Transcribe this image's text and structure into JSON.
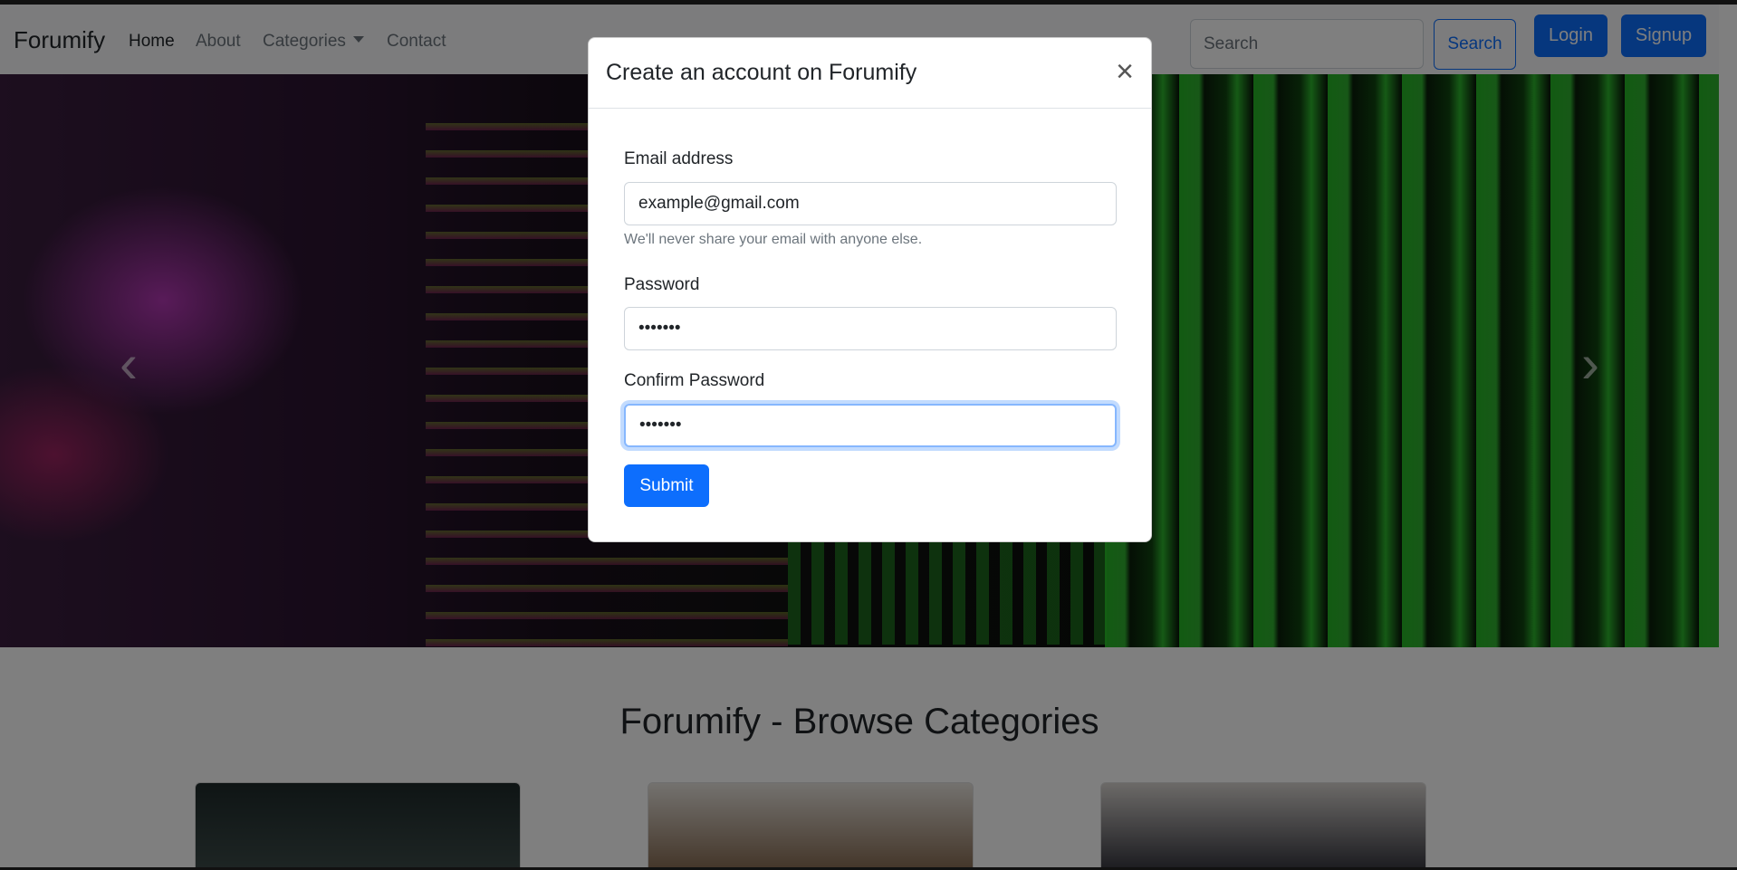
{
  "navbar": {
    "brand": "Forumify",
    "links": {
      "home": "Home",
      "about": "About",
      "categories": "Categories",
      "contact": "Contact"
    },
    "search": {
      "placeholder": "Search",
      "value": ""
    },
    "search_button": "Search",
    "login_button": "Login",
    "signup_button": "Signup"
  },
  "carousel": {
    "prev_icon": "chevron-left-icon",
    "next_icon": "chevron-right-icon",
    "prev_glyph": "‹",
    "next_glyph": "›"
  },
  "section": {
    "title": "Forumify - Browse Categories"
  },
  "modal": {
    "title": "Create an account on Forumify",
    "close_glyph": "×",
    "email": {
      "label": "Email address",
      "value": "example@gmail.com",
      "help": "We'll never share your email with anyone else."
    },
    "password": {
      "label": "Password",
      "value": "•••••••"
    },
    "confirm_password": {
      "label": "Confirm Password",
      "value": "•••••••"
    },
    "submit_label": "Submit"
  },
  "colors": {
    "primary": "#0d6efd",
    "navbar_bg": "#f8f9fa",
    "backdrop": "rgba(0,0,0,0.5)"
  }
}
